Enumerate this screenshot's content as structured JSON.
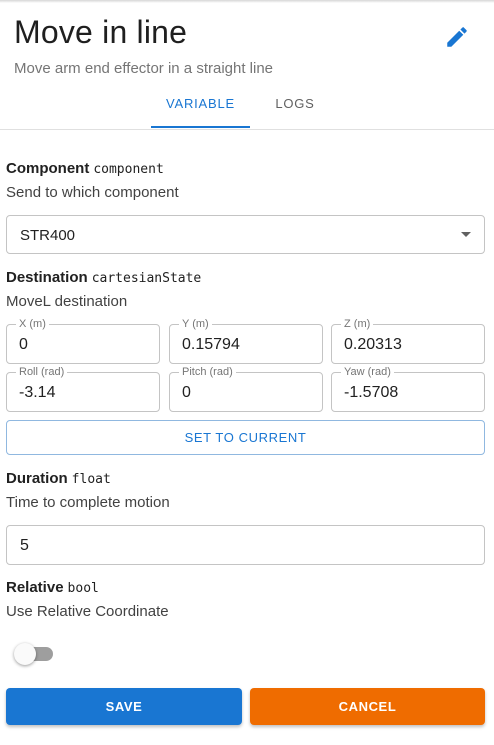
{
  "header": {
    "title": "Move in line",
    "subtitle": "Move arm end effector in a straight line",
    "edit_icon": "pencil-icon"
  },
  "tabs": [
    {
      "label": "VARIABLE",
      "active": true
    },
    {
      "label": "LOGS",
      "active": false
    }
  ],
  "colors": {
    "primary": "#1976d2",
    "cancel": "#ef6c00"
  },
  "component": {
    "title": "Component",
    "type": "component",
    "description": "Send to which component",
    "selected": "STR400"
  },
  "destination": {
    "title": "Destination",
    "type": "cartesianState",
    "description": "MoveL destination",
    "fields": [
      {
        "label": "X (m)",
        "value": "0"
      },
      {
        "label": "Y (m)",
        "value": "0.15794"
      },
      {
        "label": "Z (m)",
        "value": "0.20313"
      },
      {
        "label": "Roll (rad)",
        "value": "-3.14"
      },
      {
        "label": "Pitch (rad)",
        "value": "0"
      },
      {
        "label": "Yaw (rad)",
        "value": "-1.5708"
      }
    ],
    "set_current_label": "SET TO CURRENT"
  },
  "duration": {
    "title": "Duration",
    "type": "float",
    "description": "Time to complete motion",
    "value": "5"
  },
  "relative": {
    "title": "Relative",
    "type": "bool",
    "description": "Use Relative Coordinate",
    "checked": false
  },
  "actions": {
    "save_label": "SAVE",
    "cancel_label": "CANCEL"
  }
}
